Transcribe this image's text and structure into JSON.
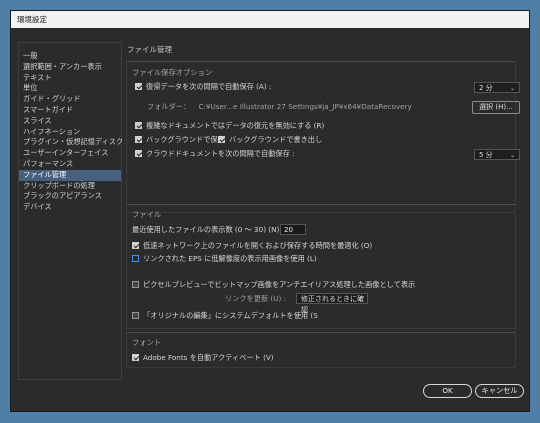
{
  "window": {
    "title": "環境設定"
  },
  "sidebar": {
    "items": [
      {
        "label": "一般"
      },
      {
        "label": "選択範囲・アンカー表示"
      },
      {
        "label": "テキスト"
      },
      {
        "label": "単位"
      },
      {
        "label": "ガイド・グリッド"
      },
      {
        "label": "スマートガイド"
      },
      {
        "label": "スライス"
      },
      {
        "label": "ハイフネーション"
      },
      {
        "label": "プラグイン・仮想記憶ディスク"
      },
      {
        "label": "ユーザーインターフェイス"
      },
      {
        "label": "パフォーマンス"
      },
      {
        "label": "ファイル管理",
        "active": true
      },
      {
        "label": "クリップボードの処理"
      },
      {
        "label": "ブラックのアピアランス"
      },
      {
        "label": "デバイス"
      }
    ]
  },
  "main": {
    "title": "ファイル管理",
    "save_options": {
      "title": "ファイル保存オプション",
      "autosave": {
        "label": "復帰データを次の間隔で自動保存 (A) :",
        "checked": true
      },
      "autosave_interval": "2 分",
      "folder_label": "フォルダー：",
      "folder_path": "C:¥User...e Illustrator 27 Settings¥ja_JP¥x64¥DataRecovery",
      "choose_button": "選択 (H)...",
      "disable_recovery": {
        "label": "複雑なドキュメントではデータの復元を無効にする (R)",
        "checked": true
      },
      "background_save": {
        "label": "バックグラウンドで保存",
        "checked": true
      },
      "background_export": {
        "label": "バックグラウンドで書き出し",
        "checked": true
      },
      "cloud_autosave": {
        "label": "クラウドドキュメントを次の間隔で自動保存 :",
        "checked": true
      },
      "cloud_interval": "5 分"
    },
    "files": {
      "title": "ファイル",
      "recent_label": "最近使用したファイルの表示数 (0 ～ 30) (N) :",
      "recent_value": "20",
      "low_bandwidth": {
        "label": "低速ネットワーク上のファイルを開くおよび保存する時間を最適化 (O)",
        "checked": true
      },
      "eps_preview": {
        "label": "リンクされた EPS に低解像度の表示用画像を使用 (L)",
        "checked": false
      },
      "antialias": {
        "label": "ピクセルプレビューでビットマップ画像をアンチエイリアス処理した画像として表示",
        "checked": false
      },
      "update_links_label": "リンクを更新 (U) :",
      "update_links_value": "修正されるときに確認",
      "edit_original": {
        "label": "「オリジナルの編集」にシステムデフォルトを使用 (S",
        "checked": false
      }
    },
    "fonts": {
      "title": "フォント",
      "activate": {
        "label": "Adobe Fonts を自動アクティベート (V)",
        "checked": true
      }
    }
  },
  "footer": {
    "ok": "OK",
    "cancel": "キャンセル"
  }
}
